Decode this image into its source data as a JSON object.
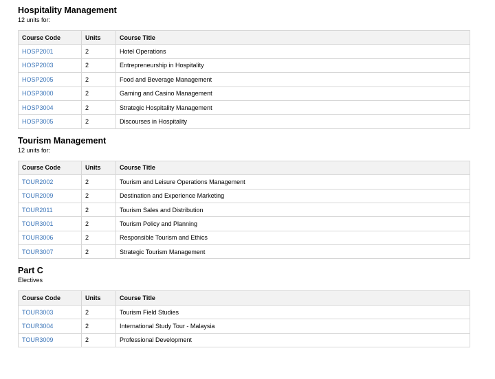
{
  "sections": [
    {
      "title": "Hospitality Management",
      "subtitle": "12 units for:",
      "headers": [
        "Course Code",
        "Units",
        "Course Title"
      ],
      "rows": [
        {
          "code": "HOSP2001",
          "units": "2",
          "title": "Hotel Operations"
        },
        {
          "code": "HOSP2003",
          "units": "2",
          "title": "Entrepreneurship in Hospitality"
        },
        {
          "code": "HOSP2005",
          "units": "2",
          "title": "Food and Beverage Management"
        },
        {
          "code": "HOSP3000",
          "units": "2",
          "title": "Gaming and Casino Management"
        },
        {
          "code": "HOSP3004",
          "units": "2",
          "title": "Strategic Hospitality Management"
        },
        {
          "code": "HOSP3005",
          "units": "2",
          "title": "Discourses in Hospitality"
        }
      ]
    },
    {
      "title": "Tourism Management",
      "subtitle": "12 units for:",
      "headers": [
        "Course Code",
        "Units",
        "Course Title"
      ],
      "rows": [
        {
          "code": "TOUR2002",
          "units": "2",
          "title": "Tourism and Leisure Operations Management"
        },
        {
          "code": "TOUR2009",
          "units": "2",
          "title": "Destination and Experience Marketing"
        },
        {
          "code": "TOUR2011",
          "units": "2",
          "title": "Tourism Sales and Distribution"
        },
        {
          "code": "TOUR3001",
          "units": "2",
          "title": "Tourism Policy and Planning"
        },
        {
          "code": "TOUR3006",
          "units": "2",
          "title": "Responsible Tourism and Ethics"
        },
        {
          "code": "TOUR3007",
          "units": "2",
          "title": "Strategic Tourism Management"
        }
      ]
    },
    {
      "title": "Part C",
      "subtitle": "Electives",
      "headers": [
        "Course Code",
        "Units",
        "Course Title"
      ],
      "rows": [
        {
          "code": "TOUR3003",
          "units": "2",
          "title": "Tourism Field Studies"
        },
        {
          "code": "TOUR3004",
          "units": "2",
          "title": "International Study Tour - Malaysia"
        },
        {
          "code": "TOUR3009",
          "units": "2",
          "title": "Professional Development"
        }
      ]
    }
  ],
  "colors": {
    "link": "#3a74b8",
    "header_bg": "#f2f2f2",
    "border": "#d6d6d6"
  }
}
